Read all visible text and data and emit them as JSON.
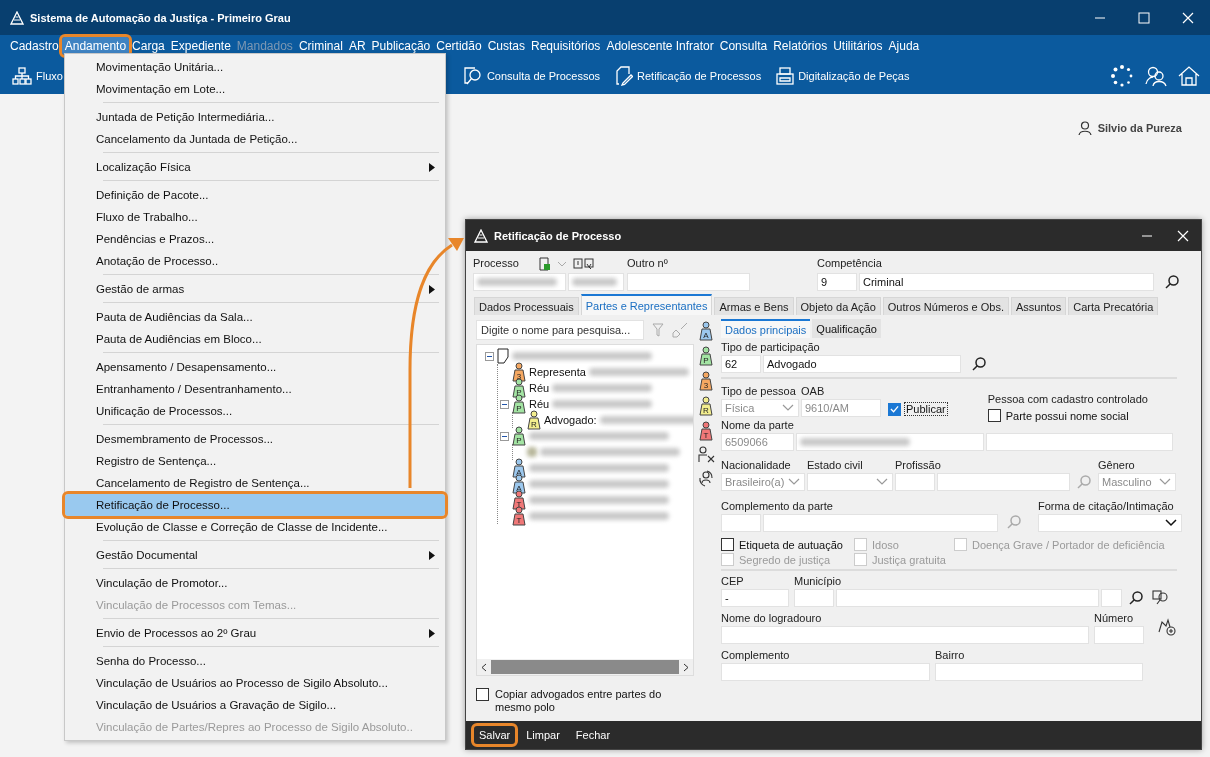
{
  "window": {
    "title": "Sistema de Automação da Justiça - Primeiro Grau"
  },
  "menu_bar": [
    {
      "label": "Cadastro",
      "selected": false,
      "disabled": false,
      "highlighted": false
    },
    {
      "label": "Andamento",
      "selected": true,
      "disabled": false,
      "highlighted": true
    },
    {
      "label": "Carga",
      "selected": false,
      "disabled": false,
      "highlighted": false
    },
    {
      "label": "Expediente",
      "selected": false,
      "disabled": false,
      "highlighted": false
    },
    {
      "label": "Mandados",
      "selected": false,
      "disabled": true,
      "highlighted": false
    },
    {
      "label": "Criminal",
      "selected": false,
      "disabled": false,
      "highlighted": false
    },
    {
      "label": "AR",
      "selected": false,
      "disabled": false,
      "highlighted": false
    },
    {
      "label": "Publicação",
      "selected": false,
      "disabled": false,
      "highlighted": false
    },
    {
      "label": "Certidão",
      "selected": false,
      "disabled": false,
      "highlighted": false
    },
    {
      "label": "Custas",
      "selected": false,
      "disabled": false,
      "highlighted": false
    },
    {
      "label": "Requisitórios",
      "selected": false,
      "disabled": false,
      "highlighted": false
    },
    {
      "label": "Adolescente Infrator",
      "selected": false,
      "disabled": false,
      "highlighted": false
    },
    {
      "label": "Consulta",
      "selected": false,
      "disabled": false,
      "highlighted": false
    },
    {
      "label": "Relatórios",
      "selected": false,
      "disabled": false,
      "highlighted": false
    },
    {
      "label": "Utilitários",
      "selected": false,
      "disabled": false,
      "highlighted": false
    },
    {
      "label": "Ajuda",
      "selected": false,
      "disabled": false,
      "highlighted": false
    }
  ],
  "toolbar": [
    {
      "label": "Fluxo",
      "kind": "flow"
    },
    {
      "label": "Consulta de Processos",
      "kind": "search"
    },
    {
      "label": "Retificação de Processos",
      "kind": "edit"
    },
    {
      "label": "Digitalização de Peças",
      "kind": "scan"
    }
  ],
  "user": {
    "name": "Silvio da Pureza"
  },
  "dropdown_menu": [
    [
      {
        "label": "Movimentação Unitária...",
        "disabled": false,
        "selected": false,
        "highlighted": false,
        "submenu": false
      },
      {
        "label": "Movimentação em Lote...",
        "disabled": false,
        "selected": false,
        "highlighted": false,
        "submenu": false
      }
    ],
    [
      {
        "label": "Juntada de Petição Intermediária...",
        "disabled": false,
        "selected": false,
        "highlighted": false,
        "submenu": false
      },
      {
        "label": "Cancelamento da Juntada de Petição...",
        "disabled": false,
        "selected": false,
        "highlighted": false,
        "submenu": false
      }
    ],
    [
      {
        "label": "Localização Física",
        "disabled": false,
        "selected": false,
        "highlighted": false,
        "submenu": true
      }
    ],
    [
      {
        "label": "Definição de Pacote...",
        "disabled": false,
        "selected": false,
        "highlighted": false,
        "submenu": false
      },
      {
        "label": "Fluxo de Trabalho...",
        "disabled": false,
        "selected": false,
        "highlighted": false,
        "submenu": false
      },
      {
        "label": "Pendências e Prazos...",
        "disabled": false,
        "selected": false,
        "highlighted": false,
        "submenu": false
      },
      {
        "label": "Anotação de Processo..",
        "disabled": false,
        "selected": false,
        "highlighted": false,
        "submenu": false
      }
    ],
    [
      {
        "label": "Gestão de armas",
        "disabled": false,
        "selected": false,
        "highlighted": false,
        "submenu": true
      }
    ],
    [
      {
        "label": "Pauta de Audiências da Sala...",
        "disabled": false,
        "selected": false,
        "highlighted": false,
        "submenu": false
      },
      {
        "label": "Pauta de Audiências em Bloco...",
        "disabled": false,
        "selected": false,
        "highlighted": false,
        "submenu": false
      }
    ],
    [
      {
        "label": "Apensamento / Desapensamento...",
        "disabled": false,
        "selected": false,
        "highlighted": false,
        "submenu": false
      },
      {
        "label": "Entranhamento / Desentranhamento...",
        "disabled": false,
        "selected": false,
        "highlighted": false,
        "submenu": false
      },
      {
        "label": "Unificação de Processos...",
        "disabled": false,
        "selected": false,
        "highlighted": false,
        "submenu": false
      }
    ],
    [
      {
        "label": "Desmembramento de Processos...",
        "disabled": false,
        "selected": false,
        "highlighted": false,
        "submenu": false
      },
      {
        "label": "Registro de Sentença...",
        "disabled": false,
        "selected": false,
        "highlighted": false,
        "submenu": false
      },
      {
        "label": "Cancelamento de Registro de Sentença...",
        "disabled": false,
        "selected": false,
        "highlighted": false,
        "submenu": false
      },
      {
        "label": "Retificação de Processo...",
        "disabled": false,
        "selected": true,
        "highlighted": true,
        "submenu": false
      },
      {
        "label": "Evolução de Classe e Correção de Classe de Incidente...",
        "disabled": false,
        "selected": false,
        "highlighted": false,
        "submenu": false
      }
    ],
    [
      {
        "label": "Gestão Documental",
        "disabled": false,
        "selected": false,
        "highlighted": false,
        "submenu": true
      }
    ],
    [
      {
        "label": "Vinculação de Promotor...",
        "disabled": false,
        "selected": false,
        "highlighted": false,
        "submenu": false
      },
      {
        "label": "Vinculação de Processos com Temas...",
        "disabled": true,
        "selected": false,
        "highlighted": false,
        "submenu": false
      }
    ],
    [
      {
        "label": "Envio de Processos ao 2º Grau",
        "disabled": false,
        "selected": false,
        "highlighted": false,
        "submenu": true
      }
    ],
    [
      {
        "label": "Senha do Processo...",
        "disabled": false,
        "selected": false,
        "highlighted": false,
        "submenu": false
      },
      {
        "label": "Vinculação de Usuários ao Processo de Sigilo Absoluto...",
        "disabled": false,
        "selected": false,
        "highlighted": false,
        "submenu": false
      },
      {
        "label": "Vinculação de Usuários a Gravação de Sigilo...",
        "disabled": false,
        "selected": false,
        "highlighted": false,
        "submenu": false
      },
      {
        "label": "Vinculação de Partes/Repres ao Processo de Sigilo Absoluto..",
        "disabled": true,
        "selected": false,
        "highlighted": false,
        "submenu": false
      }
    ]
  ],
  "dialog": {
    "title": "Retificação de Processo",
    "process_label": "Processo",
    "other_number_label": "Outro nº",
    "competence": {
      "label": "Competência",
      "code": "9",
      "name": "Criminal"
    },
    "tabs": [
      {
        "label": "Dados Processuais",
        "selected": false
      },
      {
        "label": "Partes e Representantes",
        "selected": true
      },
      {
        "label": "Armas e Bens",
        "selected": false
      },
      {
        "label": "Objeto da Ação",
        "selected": false
      },
      {
        "label": "Outros Números e Obs.",
        "selected": false
      },
      {
        "label": "Assuntos",
        "selected": false
      },
      {
        "label": "Carta Precatória",
        "selected": false
      }
    ],
    "party_search": {
      "placeholder": "Digite o nome para pesquisa..."
    },
    "tree": [
      {
        "kind": "process",
        "expanded": true,
        "children": [
          {
            "kind": "party",
            "label": "Representa",
            "badge": "3",
            "color": "#f5a862"
          },
          {
            "kind": "party",
            "label": "Réu",
            "badge": "P",
            "color": "#a3e4a3"
          },
          {
            "kind": "party",
            "label": "Réu",
            "badge": "P",
            "color": "#a3e4a3",
            "expanded": true,
            "children": [
              {
                "kind": "party",
                "label": "Advogado:",
                "badge": "R",
                "color": "#f3ee8e"
              }
            ]
          },
          {
            "kind": "party",
            "badge": "P",
            "color": "#a3e4a3",
            "expanded": true,
            "children": [
              {
                "kind": "item"
              }
            ]
          },
          {
            "kind": "party",
            "badge": "A",
            "color": "#9cc8ee"
          },
          {
            "kind": "party",
            "badge": "A",
            "color": "#9cc8ee"
          },
          {
            "kind": "party",
            "badge": "T",
            "color": "#f07878"
          },
          {
            "kind": "party",
            "badge": "T",
            "color": "#f07878"
          }
        ]
      }
    ],
    "side_tools": [
      {
        "kind": "badge",
        "badge": "A",
        "color": "#9cc8ee"
      },
      {
        "kind": "badge",
        "badge": "P",
        "color": "#a3e4a3"
      },
      {
        "kind": "badge",
        "badge": "3",
        "color": "#f5a862"
      },
      {
        "kind": "badge",
        "badge": "R",
        "color": "#f3ee8e"
      },
      {
        "kind": "badge",
        "badge": "T",
        "color": "#f07878"
      },
      {
        "kind": "remove"
      },
      {
        "kind": "swap"
      }
    ],
    "copy_lawyers": {
      "label": "Copiar advogados entre partes do mesmo polo",
      "checked": false
    },
    "form": {
      "subtabs": [
        {
          "label": "Dados principais",
          "selected": true
        },
        {
          "label": "Qualificação",
          "selected": false
        }
      ],
      "participation": {
        "label": "Tipo de participação",
        "code": "62",
        "name": "Advogado"
      },
      "person_type": {
        "label": "Tipo de pessoa",
        "value": "Física",
        "disabled": true
      },
      "oab": {
        "label": "OAB",
        "value": "9610/AM",
        "disabled": true
      },
      "publish": {
        "label": "Publicar",
        "checked": true
      },
      "controlled": {
        "label": "Pessoa com cadastro controlado"
      },
      "social_name": {
        "label": "Parte possui nome social",
        "checked": false
      },
      "party_name": {
        "label": "Nome da parte",
        "code": "6509066",
        "disabled": true
      },
      "nationality": {
        "label": "Nacionalidade",
        "value": "Brasileiro(a)",
        "disabled": true
      },
      "marital_status": {
        "label": "Estado civil"
      },
      "profession": {
        "label": "Profissão"
      },
      "gender": {
        "label": "Gênero",
        "value": "Masculino",
        "disabled": true
      },
      "party_complement": {
        "label": "Complemento da parte"
      },
      "citation": {
        "label": "Forma de citação/Intimação"
      },
      "flags": [
        {
          "label": "Etiqueta de autuação",
          "checked": false,
          "disabled": false
        },
        {
          "label": "Idoso",
          "checked": false,
          "disabled": true
        },
        {
          "label": "Doença Grave / Portador de deficiência",
          "checked": false,
          "disabled": true
        },
        {
          "label": "Segredo de justiça",
          "checked": false,
          "disabled": true
        },
        {
          "label": "Justiça gratuita",
          "checked": false,
          "disabled": true
        }
      ],
      "cep": {
        "label": "CEP",
        "value": "-"
      },
      "city": {
        "label": "Município"
      },
      "street": {
        "label": "Nome do logradouro"
      },
      "number": {
        "label": "Número"
      },
      "complement": {
        "label": "Complemento"
      },
      "district": {
        "label": "Bairro"
      }
    },
    "buttons": [
      {
        "label": "Salvar",
        "highlighted": true
      },
      {
        "label": "Limpar",
        "highlighted": false
      },
      {
        "label": "Fechar",
        "highlighted": false
      }
    ]
  }
}
